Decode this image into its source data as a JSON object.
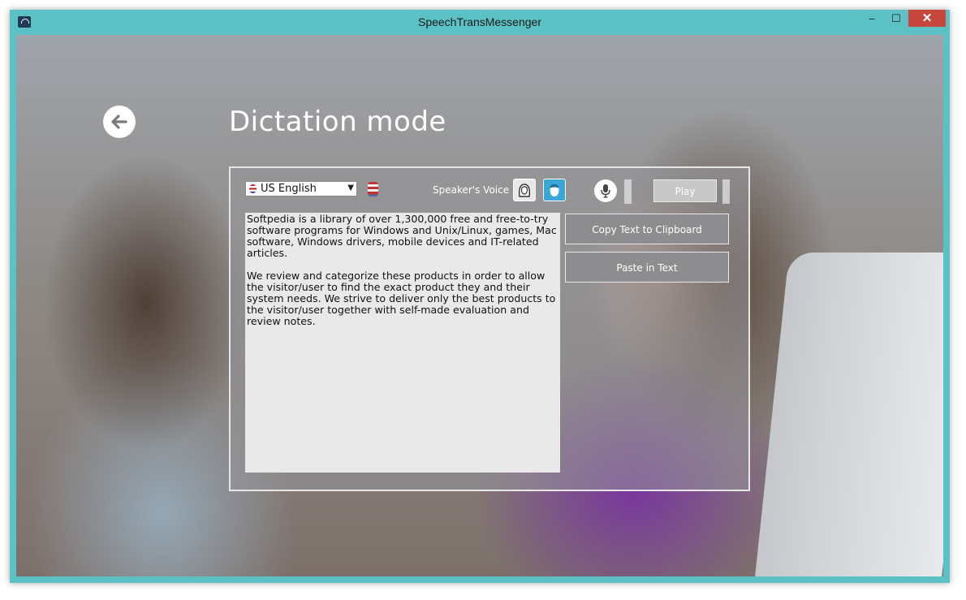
{
  "window": {
    "title": "SpeechTransMessenger",
    "controls": {
      "minimize": "–",
      "maximize": "☐",
      "close": "✕"
    }
  },
  "page": {
    "title": "Dictation mode",
    "back_icon": "arrow-left-icon"
  },
  "toolbar": {
    "language": {
      "selected": "US English",
      "flag_icon": "us-flag-icon"
    },
    "speaker_voice_label": "Speaker's Voice",
    "voices": [
      {
        "name": "female",
        "icon": "female-voice-icon",
        "selected": false
      },
      {
        "name": "male",
        "icon": "male-voice-icon",
        "selected": true
      }
    ],
    "mic_icon": "microphone-icon",
    "play_label": "Play"
  },
  "editor": {
    "paragraphs": [
      "Softpedia is a library of over 1,300,000 free and free-to-try software programs for Windows and Unix/Linux, games, Mac software, Windows drivers, mobile devices and IT-related articles.",
      "We review and categorize these products in order to allow the visitor/user to find the exact product they and their system needs. We strive to deliver only the best products to the visitor/user together with self-made evaluation and review notes."
    ]
  },
  "actions": {
    "copy_label": "Copy Text to Clipboard",
    "paste_label": "Paste in Text"
  },
  "colors": {
    "window_frame": "#5bc1c4",
    "close_button": "#c7463d",
    "male_voice_selected": "#3aa7d8"
  }
}
